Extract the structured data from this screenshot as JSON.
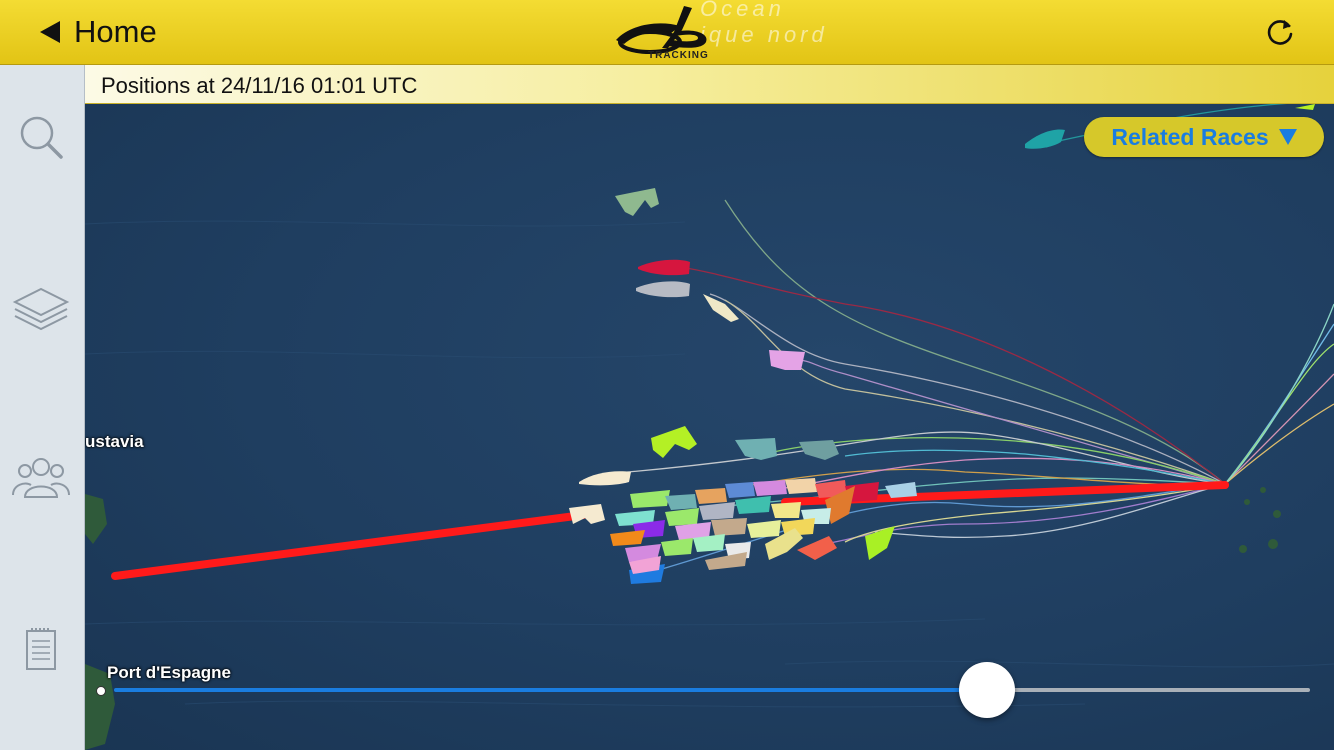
{
  "nav": {
    "back_label": "Home",
    "logo_text": "TRACKING",
    "ghost_title_line1": "Ocean",
    "ghost_title_line2": "ique nord"
  },
  "info": {
    "positions_text": "Positions at 24/11/16 01:01 UTC"
  },
  "sidebar": {
    "items": [
      {
        "name": "search",
        "icon": "search-icon"
      },
      {
        "name": "layers",
        "icon": "layers-icon"
      },
      {
        "name": "boats",
        "icon": "people-icon"
      },
      {
        "name": "notes",
        "icon": "notepad-icon"
      }
    ]
  },
  "map": {
    "related_races_label": "Related Races",
    "places": [
      {
        "name": "ustavia"
      },
      {
        "name": "Port d'Espagne"
      }
    ]
  },
  "timeline": {
    "progress": 0.73
  },
  "colors": {
    "accent": "#1a7de0",
    "bar": "#e8cd1d",
    "route": "#ff1a1a"
  }
}
